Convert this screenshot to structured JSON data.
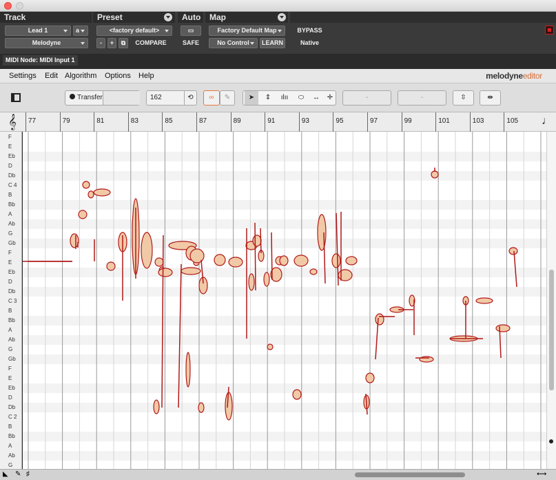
{
  "track": {
    "header": "Track",
    "name": "Lead 1",
    "slot": "a",
    "plugin": "Melodyne"
  },
  "preset": {
    "header": "Preset",
    "value": "<factory default>",
    "minus": "-",
    "plus": "+",
    "compare": "COMPARE"
  },
  "auto": {
    "header": "Auto",
    "safe": "SAFE"
  },
  "map": {
    "header": "Map",
    "value": "Factory Default Map",
    "control": "No Control",
    "learn": "LEARN",
    "bypass": "BYPASS",
    "native": "Native"
  },
  "midi_node": "MIDI Node: MIDI Input 1",
  "menu": [
    "Settings",
    "Edit",
    "Algorithm",
    "Options",
    "Help"
  ],
  "brand": {
    "name": "melodyne",
    "edition": "editor"
  },
  "toolbar": {
    "transfer": "Transfer",
    "tempo": "162",
    "field1": "-",
    "field2": "-"
  },
  "bars": [
    "77",
    "79",
    "81",
    "83",
    "85",
    "87",
    "89",
    "91",
    "93",
    "95",
    "97",
    "99",
    "101",
    "103",
    "105"
  ],
  "notes": [
    "F",
    "E",
    "Eb",
    "D",
    "Db",
    "C 4",
    "B",
    "Bb",
    "A",
    "Ab",
    "G",
    "Gb",
    "F",
    "E",
    "Eb",
    "D",
    "Db",
    "C 3",
    "B",
    "Bb",
    "A",
    "Ab",
    "G",
    "Gb",
    "F",
    "E",
    "Eb",
    "D",
    "Db",
    "C 2",
    "B",
    "Bb",
    "A",
    "Ab",
    "G"
  ],
  "colors": {
    "blob": "#b01818",
    "blob_fill": "#f1c9a6",
    "accent": "#e07a3c"
  }
}
